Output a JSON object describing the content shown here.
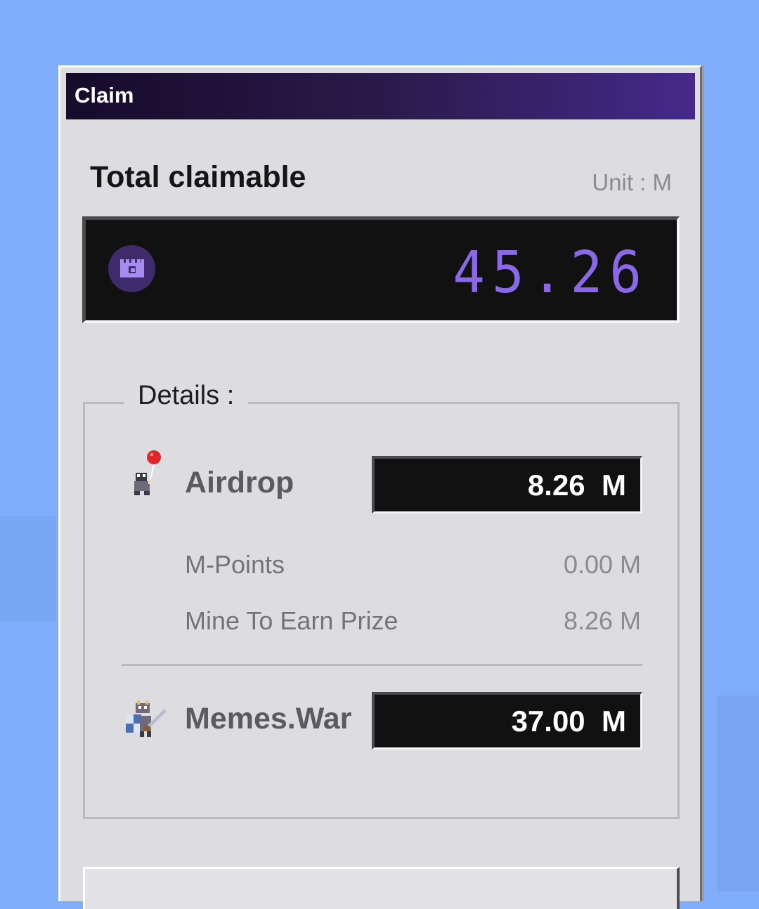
{
  "window": {
    "title": "Claim"
  },
  "total": {
    "label": "Total claimable",
    "unit": "Unit : M",
    "value": "45.26"
  },
  "details": {
    "legend": "Details :",
    "airdrop": {
      "label": "Airdrop",
      "value": "8.26  M",
      "breakdown": [
        {
          "label": "M-Points",
          "value": "0.00 M"
        },
        {
          "label": "Mine To Earn Prize",
          "value": "8.26 M"
        }
      ]
    },
    "memes_war": {
      "label": "Memes.War",
      "value": "37.00  M"
    }
  },
  "icons": {
    "coin": "purple-castle-coin-icon",
    "airdrop": "balloon-character-icon",
    "memes_war": "knight-character-icon"
  },
  "colors": {
    "background": "#7fadfc",
    "accent": "#8a68e8",
    "titlebar_start": "#150b2a",
    "titlebar_end": "#46298a"
  }
}
